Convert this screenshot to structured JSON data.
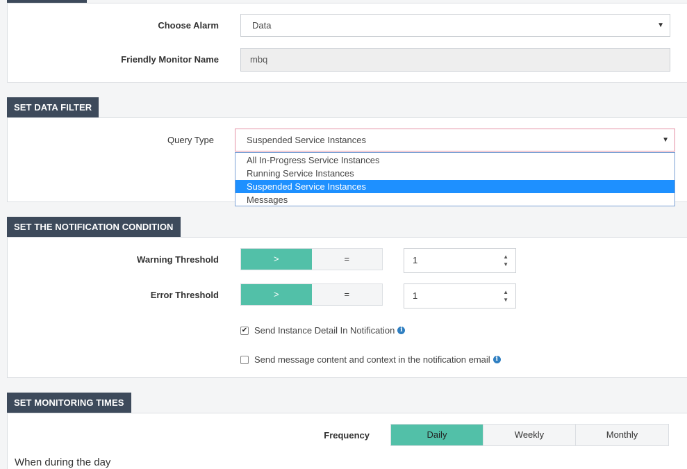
{
  "alarm": {
    "choose_label": "Choose Alarm",
    "choose_value": "Data",
    "friendly_label": "Friendly Monitor Name",
    "friendly_value": "mbq"
  },
  "data_filter": {
    "title": "SET DATA FILTER",
    "query_label": "Query Type",
    "query_value": "Suspended Service Instances",
    "options": [
      "All In-Progress Service Instances",
      "Running Service Instances",
      "Suspended Service Instances",
      "Messages"
    ],
    "selected_index": 2
  },
  "notification": {
    "title": "SET THE NOTIFICATION CONDITION",
    "warning_label": "Warning Threshold",
    "error_label": "Error Threshold",
    "op_gt": ">",
    "op_eq": "=",
    "warning_value": "1",
    "error_value": "1",
    "send_detail_label": "Send Instance Detail In Notification",
    "send_detail_checked": true,
    "send_message_label": "Send message content and context in the notification email",
    "send_message_checked": false
  },
  "monitoring": {
    "title": "SET MONITORING TIMES",
    "frequency_label": "Frequency",
    "freq_daily": "Daily",
    "freq_weekly": "Weekly",
    "freq_monthly": "Monthly",
    "when_label": "When during the day"
  },
  "colors": {
    "tab_bg": "#3d4a5b",
    "accent": "#52c0a8",
    "selection": "#1e90ff"
  }
}
